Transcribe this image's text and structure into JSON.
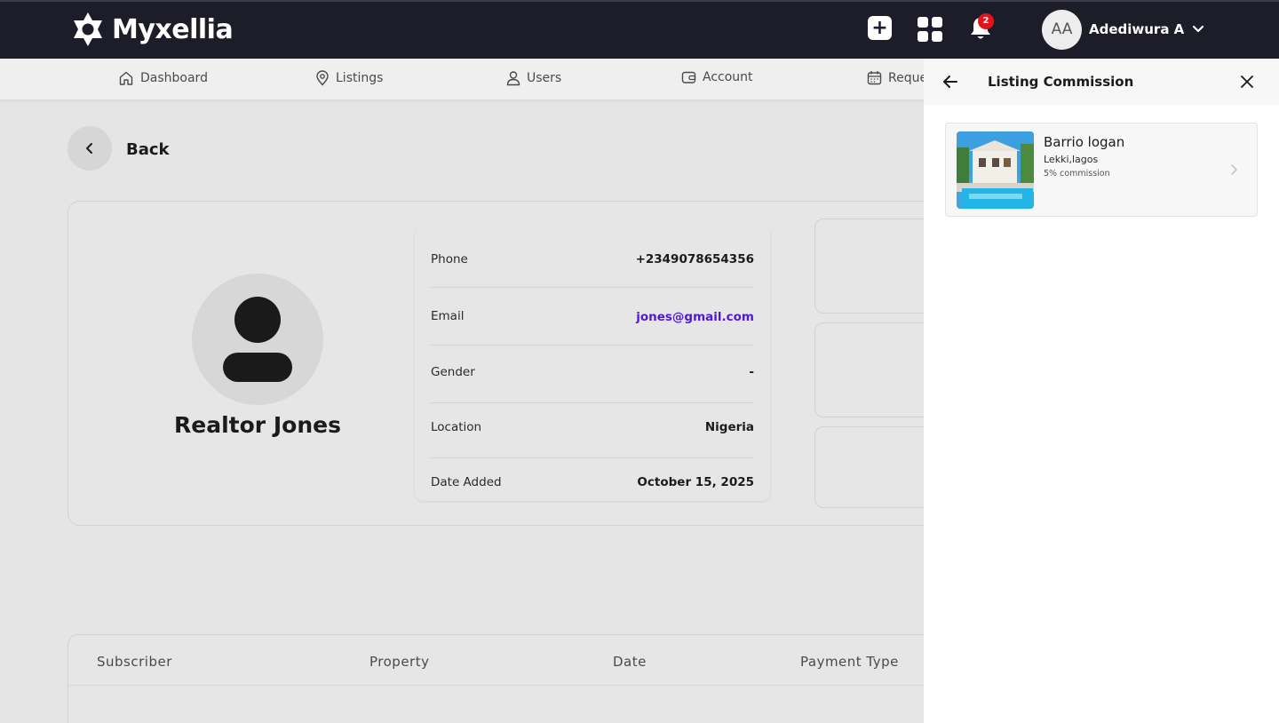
{
  "app": {
    "name": "Myxellia",
    "notification_count": "2",
    "user_initials": "AA",
    "user_name": "Adediwura A"
  },
  "nav": [
    {
      "label": "Dashboard",
      "icon": "home-icon"
    },
    {
      "label": "Listings",
      "icon": "location-pin-icon"
    },
    {
      "label": "Users",
      "icon": "user-icon"
    },
    {
      "label": "Account",
      "icon": "wallet-icon"
    },
    {
      "label": "Reque",
      "icon": "calendar-icon"
    }
  ],
  "back_label": "Back",
  "profile": {
    "name": "Realtor Jones",
    "details": [
      {
        "label": "Phone",
        "value": "+2349078654356"
      },
      {
        "label": "Email",
        "value": "jones@gmail.com"
      },
      {
        "label": "Gender",
        "value": "-"
      },
      {
        "label": "Location",
        "value": "Nigeria"
      },
      {
        "label": "Date Added",
        "value": "October 15, 2025"
      }
    ]
  },
  "table": {
    "headers": [
      "Subscriber",
      "Property",
      "Date",
      "Payment Type"
    ]
  },
  "panel": {
    "title": "Listing Commission",
    "listings": [
      {
        "name": "Barrio logan",
        "location": "Lekki,lagos",
        "commission": "5% commission"
      }
    ]
  },
  "colors": {
    "topbar": "#1c1d29",
    "email_link": "#4f1ad6",
    "badge": "#e5141b"
  }
}
